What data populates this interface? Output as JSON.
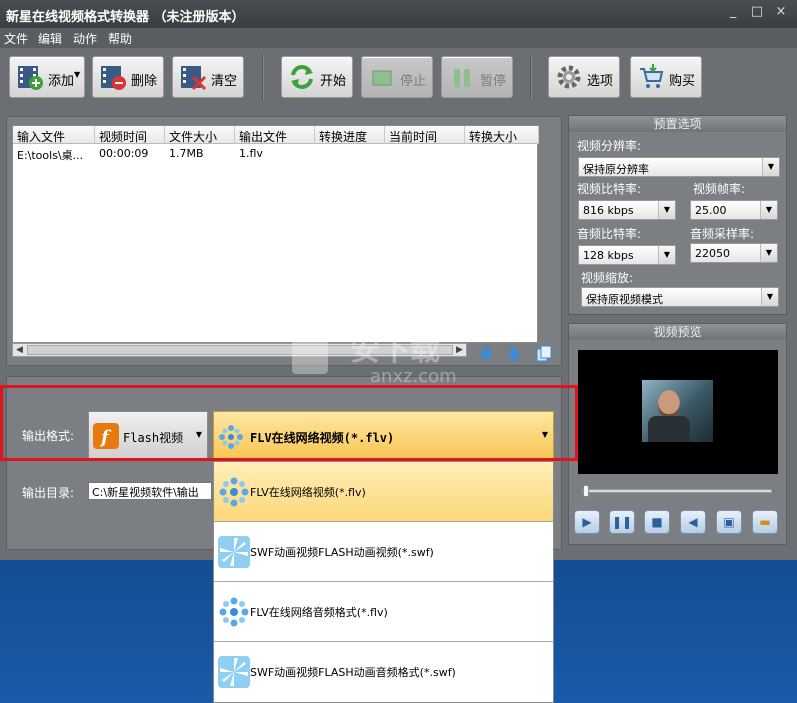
{
  "window": {
    "title": "新星在线视频格式转换器 （未注册版本）",
    "controls": [
      "_",
      "□",
      "×"
    ]
  },
  "menu": [
    "文件",
    "编辑",
    "动作",
    "帮助"
  ],
  "toolbar": {
    "add": "添加",
    "delete": "删除",
    "clear": "清空",
    "start": "开始",
    "stop": "停止",
    "pause": "暂停",
    "options": "选项",
    "buy": "购买"
  },
  "filelist": {
    "columns": [
      "输入文件",
      "视频时间",
      "文件大小",
      "输出文件",
      "转换进度",
      "当前时间",
      "转换大小"
    ],
    "rows": [
      [
        "E:\\tools\\桌...",
        "00:00:09",
        "1.7MB",
        "1.flv",
        "",
        "",
        ""
      ]
    ]
  },
  "output": {
    "format_label": "输出格式:",
    "category": "Flash视频",
    "format_selected": "FLV在线网络视频(*.flv)",
    "dir_label": "输出目录:",
    "dir_value": "C:\\新星视频软件\\输出"
  },
  "format_options": [
    "FLV在线网络视频(*.flv)",
    "SWF动画视频FLASH动画视频(*.swf)",
    "FLV在线网络音频格式(*.flv)",
    "SWF动画视频FLASH动画音频格式(*.swf)"
  ],
  "preset": {
    "header": "预置选项",
    "resolution_label": "视频分辨率:",
    "resolution_value": "保持原分辨率",
    "vbitrate_label": "视频比特率:",
    "vbitrate_value": "816 kbps",
    "fps_label": "视频帧率:",
    "fps_value": "25.00",
    "abitrate_label": "音频比特率:",
    "abitrate_value": "128 kbps",
    "samplerate_label": "音频采样率:",
    "samplerate_value": "22050",
    "scale_label": "视频缩放:",
    "scale_value": "保持原视频模式"
  },
  "preview": {
    "header": "视频预览"
  },
  "watermark": "安下载 anxz.com",
  "colors": {
    "accent_orange": "#f7c552",
    "highlight_red": "#e0141a",
    "panel_gray": "#7b7e82"
  }
}
